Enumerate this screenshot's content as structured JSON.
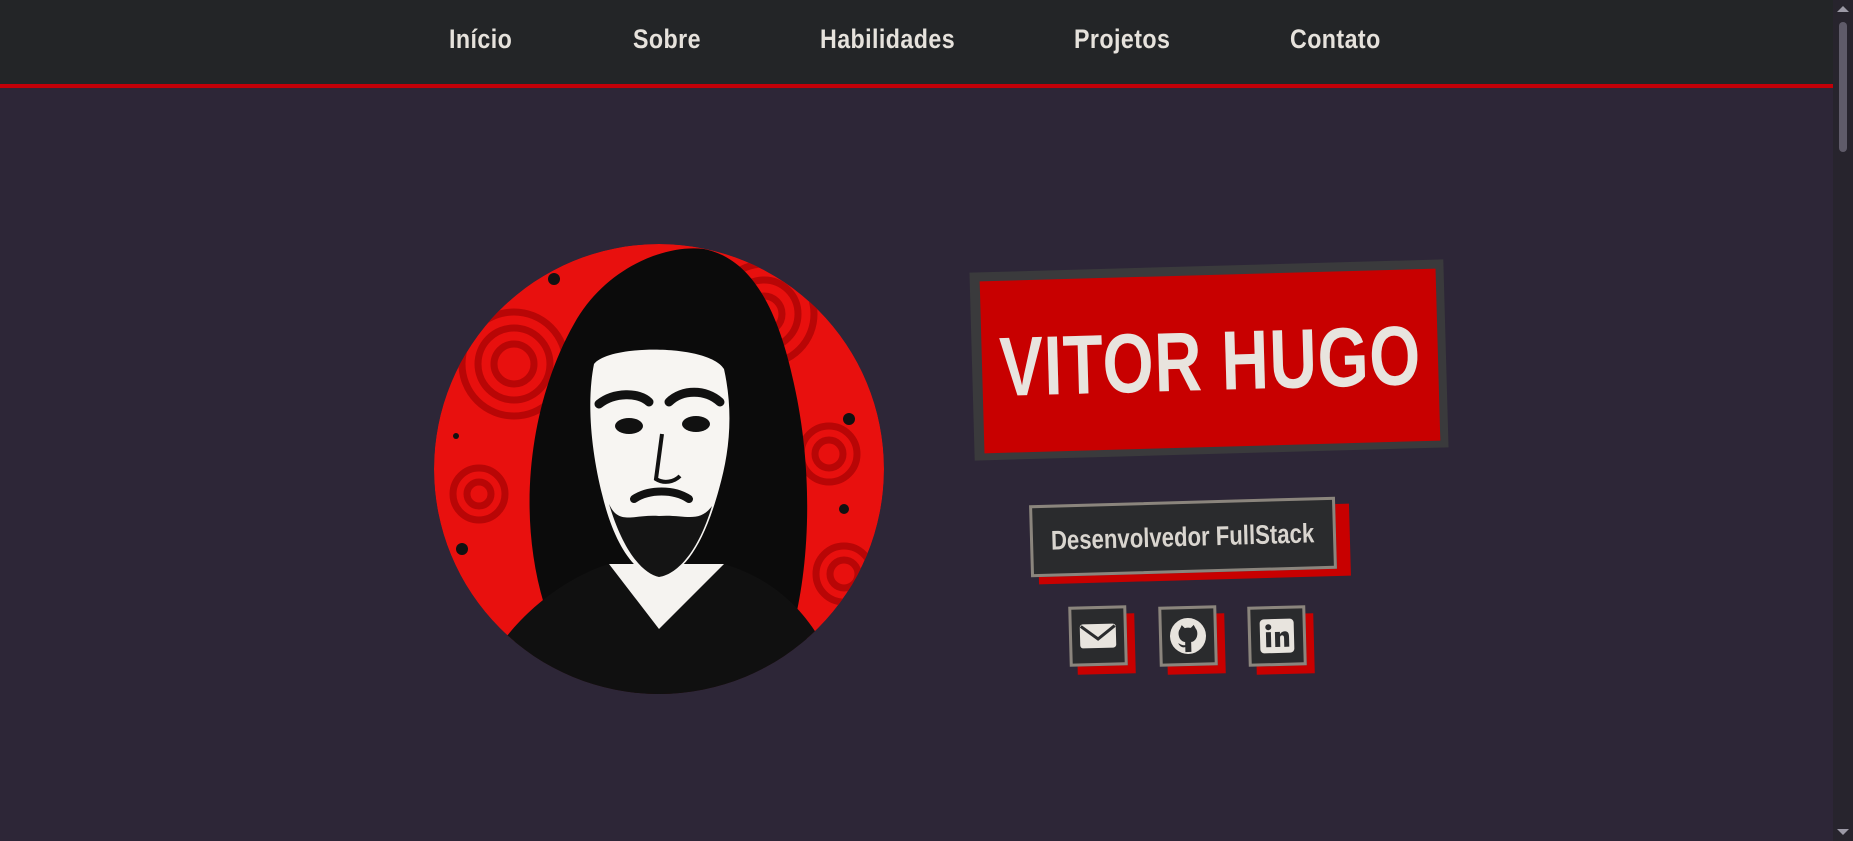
{
  "nav": {
    "items": [
      {
        "label": "Início"
      },
      {
        "label": "Sobre"
      },
      {
        "label": "Habilidades"
      },
      {
        "label": "Projetos"
      },
      {
        "label": "Contato"
      }
    ]
  },
  "hero": {
    "name": "VITOR HUGO",
    "role": "Desenvolvedor FullStack",
    "avatar_icon": "portrait-illustration"
  },
  "social": {
    "links": [
      {
        "icon": "envelope-icon"
      },
      {
        "icon": "github-icon"
      },
      {
        "icon": "linkedin-icon"
      }
    ]
  },
  "colors": {
    "background": "#2d2637",
    "navbar": "#232527",
    "accent_red": "#c80000",
    "text_light": "#e8e4de",
    "box_dark": "#2a2b2d",
    "box_border": "#8b857d"
  }
}
